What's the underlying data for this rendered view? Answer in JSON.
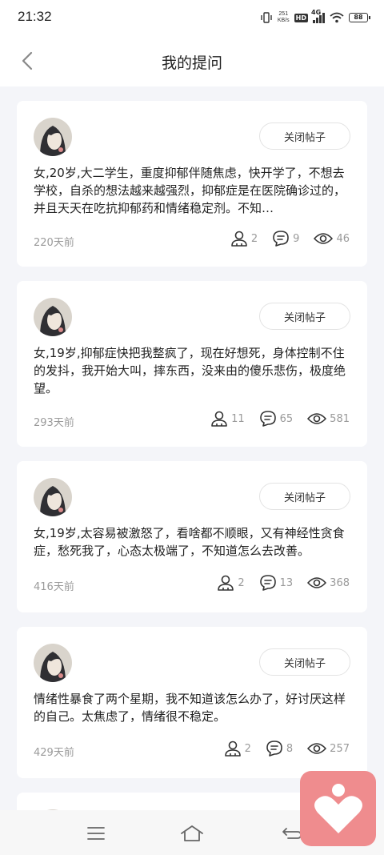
{
  "status_bar": {
    "time": "21:32",
    "speed_value": "251",
    "speed_unit": "KB/s",
    "hd": "HD",
    "network": "4G",
    "battery": "88"
  },
  "header": {
    "title": "我的提问",
    "back_icon": "chevron-left-icon"
  },
  "posts": [
    {
      "close_label": "关闭帖子",
      "text": "女,20岁,大二学生，重度抑郁伴随焦虑，快开学了，不想去学校，自杀的想法越来越强烈，抑郁症是在医院确诊过的，并且天天在吃抗抑郁药和情绪稳定剂。不知…",
      "time": "220天前",
      "followers": "2",
      "comments": "9",
      "views": "46"
    },
    {
      "close_label": "关闭帖子",
      "text": "女,19岁,抑郁症快把我整疯了，现在好想死，身体控制不住的发抖，我开始大叫，摔东西，没来由的傻乐悲伤，极度绝望。",
      "time": "293天前",
      "followers": "11",
      "comments": "65",
      "views": "581"
    },
    {
      "close_label": "关闭帖子",
      "text": "女,19岁,太容易被激怒了，看啥都不顺眼，又有神经性贪食症，愁死我了，心态太极端了，不知道怎么去改善。",
      "time": "416天前",
      "followers": "2",
      "comments": "13",
      "views": "368"
    },
    {
      "close_label": "关闭帖子",
      "text": "情绪性暴食了两个星期，我不知道该怎么办了，好讨厌这样的自己。太焦虑了，情绪很不稳定。",
      "time": "429天前",
      "followers": "2",
      "comments": "8",
      "views": "257"
    }
  ],
  "icons": {
    "followers": "person-icon",
    "comments": "comment-icon",
    "views": "eye-icon"
  },
  "colors": {
    "background": "#f4f5f9",
    "card": "#ffffff",
    "muted": "#9a9a9a",
    "float_button": "#ef8c8e"
  }
}
